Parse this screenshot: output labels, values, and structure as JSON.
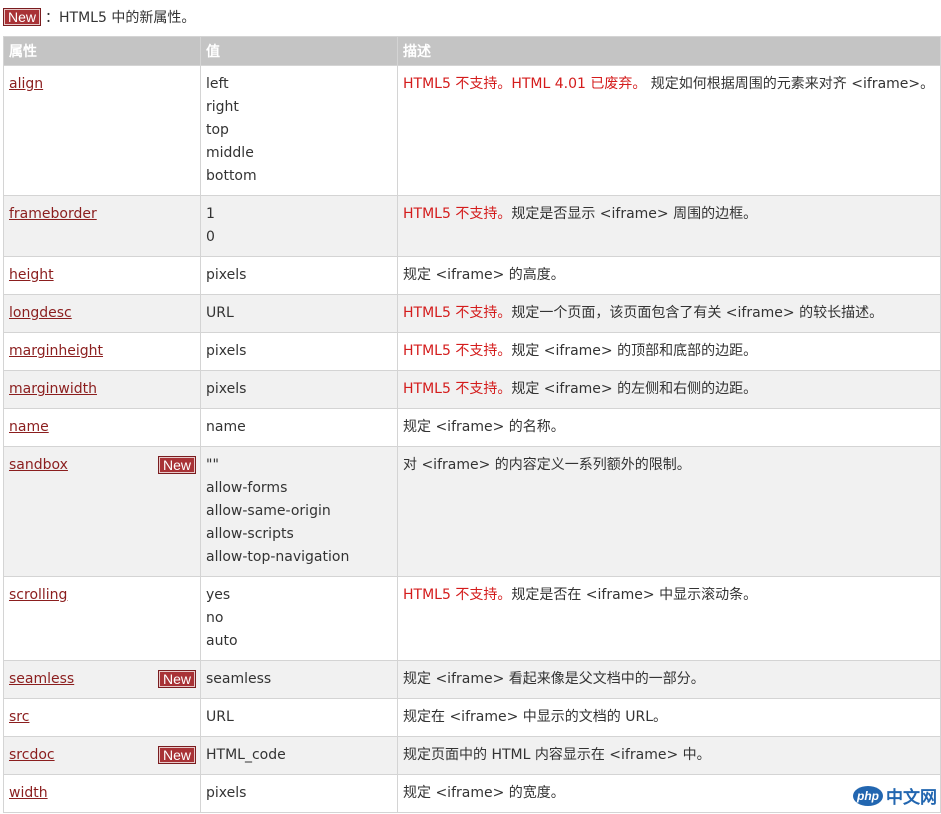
{
  "legend": {
    "badge": "New",
    "text": "：HTML5 中的新属性。"
  },
  "table": {
    "headers": [
      "属性",
      "值",
      "描述"
    ],
    "rows": [
      {
        "attr": "align",
        "values": [
          "left",
          "right",
          "top",
          "middle",
          "bottom"
        ],
        "warn": "HTML5 不支持。HTML 4.01 已废弃。",
        "desc": " 规定如何根据周围的元素来对齐 <iframe>。"
      },
      {
        "attr": "frameborder",
        "values": [
          "1",
          "0"
        ],
        "warn": "HTML5 不支持。",
        "desc": "规定是否显示 <iframe> 周围的边框。"
      },
      {
        "attr": "height",
        "values": [
          "pixels"
        ],
        "warn": "",
        "desc": "规定 <iframe> 的高度。"
      },
      {
        "attr": "longdesc",
        "values": [
          "URL"
        ],
        "warn": "HTML5 不支持。",
        "desc": "规定一个页面，该页面包含了有关 <iframe> 的较长描述。"
      },
      {
        "attr": "marginheight",
        "values": [
          "pixels"
        ],
        "warn": "HTML5 不支持。",
        "desc": "规定 <iframe> 的顶部和底部的边距。"
      },
      {
        "attr": "marginwidth",
        "values": [
          "pixels"
        ],
        "warn": "HTML5 不支持。",
        "desc": "规定 <iframe> 的左侧和右侧的边距。"
      },
      {
        "attr": "name",
        "values": [
          "name"
        ],
        "warn": "",
        "desc": "规定 <iframe> 的名称。"
      },
      {
        "attr": "sandbox",
        "badge": "New",
        "values": [
          "\"\"",
          "allow-forms",
          "allow-same-origin",
          "allow-scripts",
          "allow-top-navigation"
        ],
        "warn": "",
        "desc": "对 <iframe> 的内容定义一系列额外的限制。"
      },
      {
        "attr": "scrolling",
        "values": [
          "yes",
          "no",
          "auto"
        ],
        "warn": "HTML5 不支持。",
        "desc": "规定是否在 <iframe> 中显示滚动条。"
      },
      {
        "attr": "seamless",
        "badge": "New",
        "values": [
          "seamless"
        ],
        "warn": "",
        "desc": "规定 <iframe> 看起来像是父文档中的一部分。"
      },
      {
        "attr": "src",
        "values": [
          "URL"
        ],
        "warn": "",
        "desc": "规定在 <iframe> 中显示的文档的 URL。"
      },
      {
        "attr": "srcdoc",
        "badge": "New",
        "values": [
          "HTML_code"
        ],
        "warn": "",
        "desc": "规定页面中的 HTML 内容显示在 <iframe> 中。"
      },
      {
        "attr": "width",
        "values": [
          "pixels"
        ],
        "warn": "",
        "desc": "规定 <iframe> 的宽度。"
      }
    ]
  },
  "watermark": {
    "logo": "php",
    "text": "中文网"
  },
  "colors": {
    "badge": "#a83236",
    "link": "#8b1e1e",
    "warn": "#d41c1c",
    "header": "#c4c4c4",
    "shade": "#f1f1f1"
  }
}
